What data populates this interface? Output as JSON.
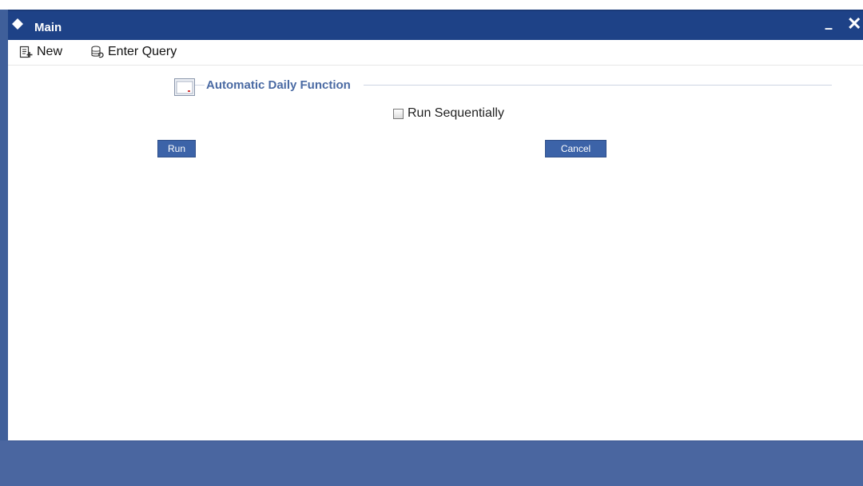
{
  "window": {
    "title": "Main",
    "minimize_glyph": "–",
    "close_glyph": "✕"
  },
  "toolbar": {
    "new_label": "New",
    "enter_query_label": "Enter Query"
  },
  "fieldset": {
    "legend": "Automatic Daily Function"
  },
  "options": {
    "run_sequentially_label": "Run Sequentially",
    "run_sequentially_checked": false
  },
  "actions": {
    "run_label": "Run",
    "cancel_label": "Cancel"
  },
  "colors": {
    "titlebar": "#1e4287",
    "footer": "#4a66a0",
    "button": "#3c63a8",
    "legend_text": "#4a6aa3"
  },
  "icons": {
    "title": "diamond-icon",
    "new": "new-document-icon",
    "enter_query": "query-icon",
    "fieldset": "section-collapse-icon"
  }
}
